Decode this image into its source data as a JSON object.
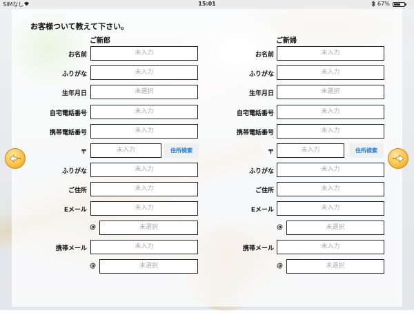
{
  "status_bar": {
    "carrier": "SIMなし",
    "time": "15:01",
    "battery_pct": "67%",
    "battery_level": 0.67
  },
  "form": {
    "heading": "お客様ついて教えて下さい。",
    "groom": {
      "title": "ご新郎",
      "rows": [
        {
          "label": "お名前",
          "placeholder": "未入力"
        },
        {
          "label": "ふりがな",
          "placeholder": "未入力"
        },
        {
          "label": "生年月日",
          "placeholder": "未選択"
        },
        {
          "label": "自宅電話番号",
          "placeholder": "未入力"
        },
        {
          "label": "携帯電話番号",
          "placeholder": "未入力"
        },
        {
          "label": "〒",
          "placeholder": "未入力",
          "button": "住所検索"
        },
        {
          "label": "ふりがな",
          "placeholder": "未入力"
        },
        {
          "label": "ご住所",
          "placeholder": "未入力"
        },
        {
          "label": "Eメール",
          "placeholder": "未入力"
        },
        {
          "label": "@",
          "placeholder": "未選択"
        },
        {
          "label": "携帯メール",
          "placeholder": "未入力"
        },
        {
          "label": "@",
          "placeholder": "未選択"
        }
      ]
    },
    "bride": {
      "title": "ご新婦",
      "rows": [
        {
          "label": "お名前",
          "placeholder": "未入力"
        },
        {
          "label": "ふりがな",
          "placeholder": "未入力"
        },
        {
          "label": "生年月日",
          "placeholder": "未選択"
        },
        {
          "label": "自宅電話番号",
          "placeholder": "未入力"
        },
        {
          "label": "携帯電話番号",
          "placeholder": "未入力"
        },
        {
          "label": "〒",
          "placeholder": "未入力",
          "button": "住所検索"
        },
        {
          "label": "ふりがな",
          "placeholder": "未入力"
        },
        {
          "label": "ご住所",
          "placeholder": "未入力"
        },
        {
          "label": "Eメール",
          "placeholder": "未入力"
        },
        {
          "label": "@",
          "placeholder": "未選択"
        },
        {
          "label": "携帯メール",
          "placeholder": "未入力"
        },
        {
          "label": "@",
          "placeholder": "未選択"
        }
      ]
    }
  },
  "nav": {
    "prev_icon": "left-arrow-icon",
    "next_icon": "right-arrow-icon",
    "accent_color": "#f7c24d"
  }
}
